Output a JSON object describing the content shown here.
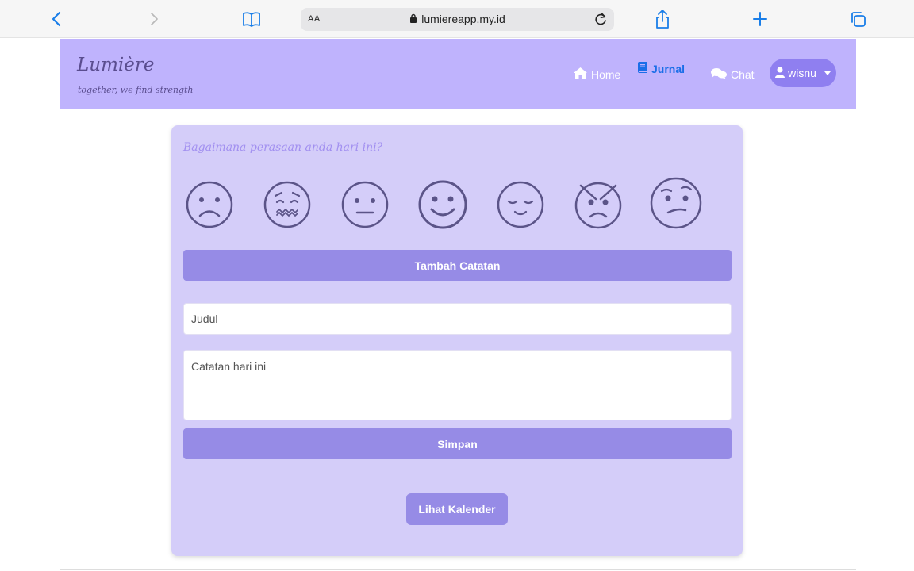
{
  "browser": {
    "text_size_label": "AA",
    "url": "lumiereapp.my.id",
    "accent_color": "#1a7ee8"
  },
  "header": {
    "brand_title": "Lumière",
    "brand_tagline": "together, we find strength",
    "nav": {
      "home": "Home",
      "journal": "Jurnal",
      "chat": "Chat"
    },
    "user_name": "wisnu",
    "background_color": "#bfb3fd"
  },
  "card": {
    "question": "Bagaimana perasaan anda hari ini?",
    "moods": [
      "sad-face-icon",
      "anxious-face-icon",
      "neutral-face-icon",
      "happy-face-icon",
      "content-face-icon",
      "angry-face-icon",
      "confused-face-icon"
    ],
    "add_note_label": "Tambah Catatan",
    "title_placeholder": "Judul",
    "note_placeholder": "Catatan hari ini",
    "save_label": "Simpan",
    "calendar_label": "Lihat Kalender",
    "background_color": "#d4cdf9",
    "button_color": "#968be6"
  }
}
